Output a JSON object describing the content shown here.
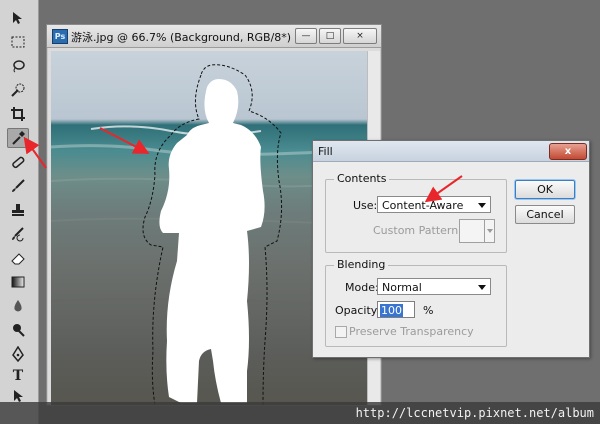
{
  "doc": {
    "title": "游泳.jpg @ 66.7% (Background, RGB/8*) *",
    "app_badge": "Ps",
    "controls": [
      "—",
      "□",
      "×"
    ]
  },
  "dialog": {
    "title": "Fill",
    "close_label": "x",
    "contents_group": "Contents",
    "use_label": "Use:",
    "use_value": "Content-Aware",
    "custom_pattern_label": "Custom Pattern:",
    "blending_group": "Blending",
    "mode_label": "Mode:",
    "mode_value": "Normal",
    "opacity_label": "Opacity:",
    "opacity_value": "100",
    "opacity_unit": "%",
    "preserve_label": "Preserve Transparency",
    "ok_label": "OK",
    "cancel_label": "Cancel"
  },
  "tools": {
    "items": [
      {
        "icon": "move-tool-icon"
      },
      {
        "icon": "marquee-tool-icon"
      },
      {
        "icon": "lasso-tool-icon"
      },
      {
        "icon": "quick-selection-tool-icon"
      },
      {
        "icon": "crop-tool-icon"
      },
      {
        "icon": "eyedropper-tool-icon",
        "active": true
      },
      {
        "icon": "healing-brush-tool-icon"
      },
      {
        "icon": "brush-tool-icon"
      },
      {
        "icon": "clone-stamp-tool-icon"
      },
      {
        "icon": "history-brush-tool-icon"
      },
      {
        "icon": "eraser-tool-icon"
      },
      {
        "icon": "gradient-tool-icon"
      },
      {
        "icon": "blur-tool-icon"
      },
      {
        "icon": "dodge-tool-icon"
      },
      {
        "icon": "pen-tool-icon"
      },
      {
        "icon": "type-tool-icon"
      },
      {
        "icon": "path-selection-tool-icon"
      },
      {
        "icon": "rectangle-tool-icon"
      }
    ]
  },
  "watermark": "http://lccnetvip.pixnet.net/album",
  "colors": {
    "annotation_arrow": "#e8262c",
    "selection_fill": "#ffffff",
    "accent_button": "#3a7fc4"
  }
}
